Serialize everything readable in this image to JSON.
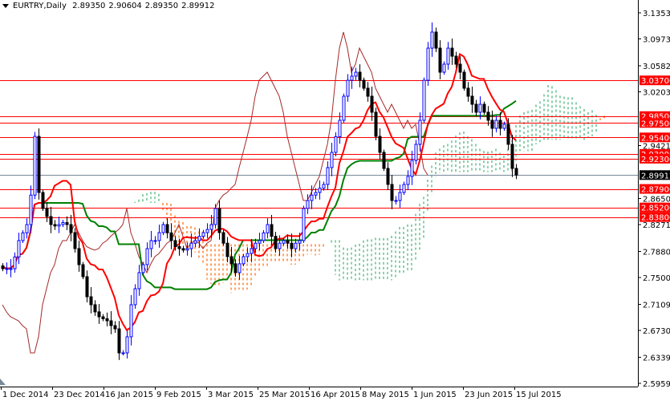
{
  "header": {
    "symbol": "EURTRY,Daily",
    "open": "2.89350",
    "high": "2.90604",
    "low": "2.89350",
    "close": "2.89912"
  },
  "chart_data": {
    "type": "candlestick",
    "title": "EURTRY,Daily",
    "indicator": "Ichimoku Kinko Hyo (9, 26, 52)",
    "ylim": [
      2.59595,
      3.1353
    ],
    "y_ticks": [
      "3.13530",
      "3.09735",
      "3.05825",
      "3.02030",
      "2.94210",
      "2.86505",
      "2.82710",
      "2.78800",
      "2.75005",
      "2.71095",
      "2.67300",
      "2.63390",
      "2.59595"
    ],
    "x_ticks": [
      "1 Dec 2014",
      "23 Dec 2014",
      "16 Jan 2015",
      "9 Feb 2015",
      "3 Mar 2015",
      "25 Mar 2015",
      "16 Apr 2015",
      "8 May 2015",
      "1 Jun 2015",
      "23 Jun 2015",
      "15 Jul 2015"
    ],
    "current_price": {
      "value": 2.89912,
      "label": "2.89912"
    },
    "levels": [
      {
        "value": 3.037,
        "label": "3.03700"
      },
      {
        "value": 2.985,
        "label": "2.98500"
      },
      {
        "value": 2.975,
        "label": "2.97500"
      },
      {
        "value": 2.954,
        "label": "2.95400"
      },
      {
        "value": 2.93,
        "label": "2.93000"
      },
      {
        "value": 2.923,
        "label": "2.92300"
      },
      {
        "value": 2.879,
        "label": "2.87900"
      },
      {
        "value": 2.852,
        "label": "2.85200"
      },
      {
        "value": 2.838,
        "label": "2.83800"
      }
    ],
    "closes": [
      2.7629,
      2.7629,
      2.7629,
      2.78,
      2.8038,
      2.815,
      2.8271,
      2.87,
      2.9555,
      2.8738,
      2.8505,
      2.8388,
      2.8271,
      2.825,
      2.8271,
      2.83,
      2.8271,
      2.8154,
      2.7921,
      2.7687,
      2.7512,
      2.722,
      2.7104,
      2.7,
      2.6928,
      2.69,
      2.687,
      2.68,
      2.6753,
      2.6403,
      2.6403,
      2.6637,
      2.7104,
      2.7337,
      2.7571,
      2.7687,
      2.7921,
      2.8038,
      2.8038,
      2.8154,
      2.8271,
      2.815,
      2.8038,
      2.795,
      2.7921,
      2.79,
      2.7921,
      2.8,
      2.8038,
      2.81,
      2.8154,
      2.82,
      2.8271,
      2.8505,
      2.8154,
      2.8,
      2.7804,
      2.77,
      2.7571,
      2.77,
      2.7804,
      2.785,
      2.7921,
      2.8,
      2.8038,
      2.815,
      2.8271,
      2.81,
      2.7921,
      2.8,
      2.8038,
      2.8,
      2.7921,
      2.8,
      2.8038,
      2.8505,
      2.8621,
      2.87,
      2.8738,
      2.88,
      2.8855,
      2.91,
      2.9322,
      2.955,
      2.9789,
      3.0139,
      3.0372,
      3.0431,
      3.0489,
      3.0372,
      3.0256,
      3.0139,
      2.9906,
      2.9555,
      2.9322,
      2.9088,
      2.8855,
      2.8621,
      2.8621,
      2.8738,
      2.8855,
      2.8972,
      2.9205,
      2.9439,
      2.9789,
      3.0372,
      3.0839,
      3.1073,
      3.0839,
      3.0489,
      3.0606,
      3.0839,
      3.0722,
      3.0606,
      3.0489,
      3.0256,
      3.0139,
      3.0022,
      2.9906,
      3.0022,
      2.9906,
      2.9789,
      2.9672,
      2.9789,
      2.9672,
      2.973,
      2.9439,
      2.9088,
      2.8991
    ],
    "colors": {
      "bull": "#0000ff",
      "bear": "#000000",
      "tenkan": "#ff0000",
      "kijun": "#008000",
      "chikou": "#a52a2a",
      "cloud_up": "#3cb371",
      "cloud_down": "#ff6600",
      "level": "#ff0000",
      "current": "#778899"
    }
  }
}
